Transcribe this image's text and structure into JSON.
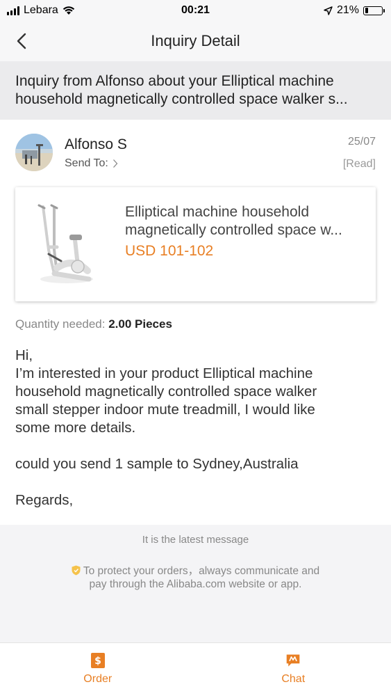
{
  "status_bar": {
    "carrier": "Lebara",
    "time": "00:21",
    "battery": "21%",
    "battery_level": 0.21,
    "icons": [
      "signal-icon",
      "wifi-icon",
      "location-arrow-icon",
      "battery-icon"
    ]
  },
  "nav": {
    "title": "Inquiry Detail",
    "back_icon": "chevron-left-icon"
  },
  "subject": {
    "line1": "Inquiry from Alfonso about your Elliptical machine",
    "line2": "household magnetically controlled space walker s..."
  },
  "sender": {
    "name": "Alfonso S",
    "send_to_label": "Send To:",
    "date": "25/07",
    "status": "[Read]"
  },
  "product": {
    "title_line1": "Elliptical machine household",
    "title_line2": "magnetically controlled space w...",
    "price": "USD 101-102",
    "price_color": "#e87f24"
  },
  "quantity": {
    "label": "Quantity needed:",
    "value": "2.00 Pieces"
  },
  "message": {
    "greeting": "Hi,",
    "body_line1": "I’m interested in your product Elliptical machine",
    "body_line2": "household magnetically controlled space walker",
    "body_line3": "small stepper indoor mute treadmill, I would like",
    "body_line4": "some more details.",
    "request": "could you send 1 sample to Sydney,Australia",
    "signoff": "Regards,"
  },
  "footer": {
    "latest": "It is the latest message",
    "protect_line1": "To protect your orders，always communicate and",
    "protect_line2": "pay through the Alibaba.com website or app."
  },
  "tabs": [
    {
      "label": "Order",
      "icon": "order-icon"
    },
    {
      "label": "Chat",
      "icon": "chat-icon"
    }
  ],
  "colors": {
    "accent": "#e87f24",
    "background": "#f4f4f6",
    "card": "#ffffff"
  }
}
